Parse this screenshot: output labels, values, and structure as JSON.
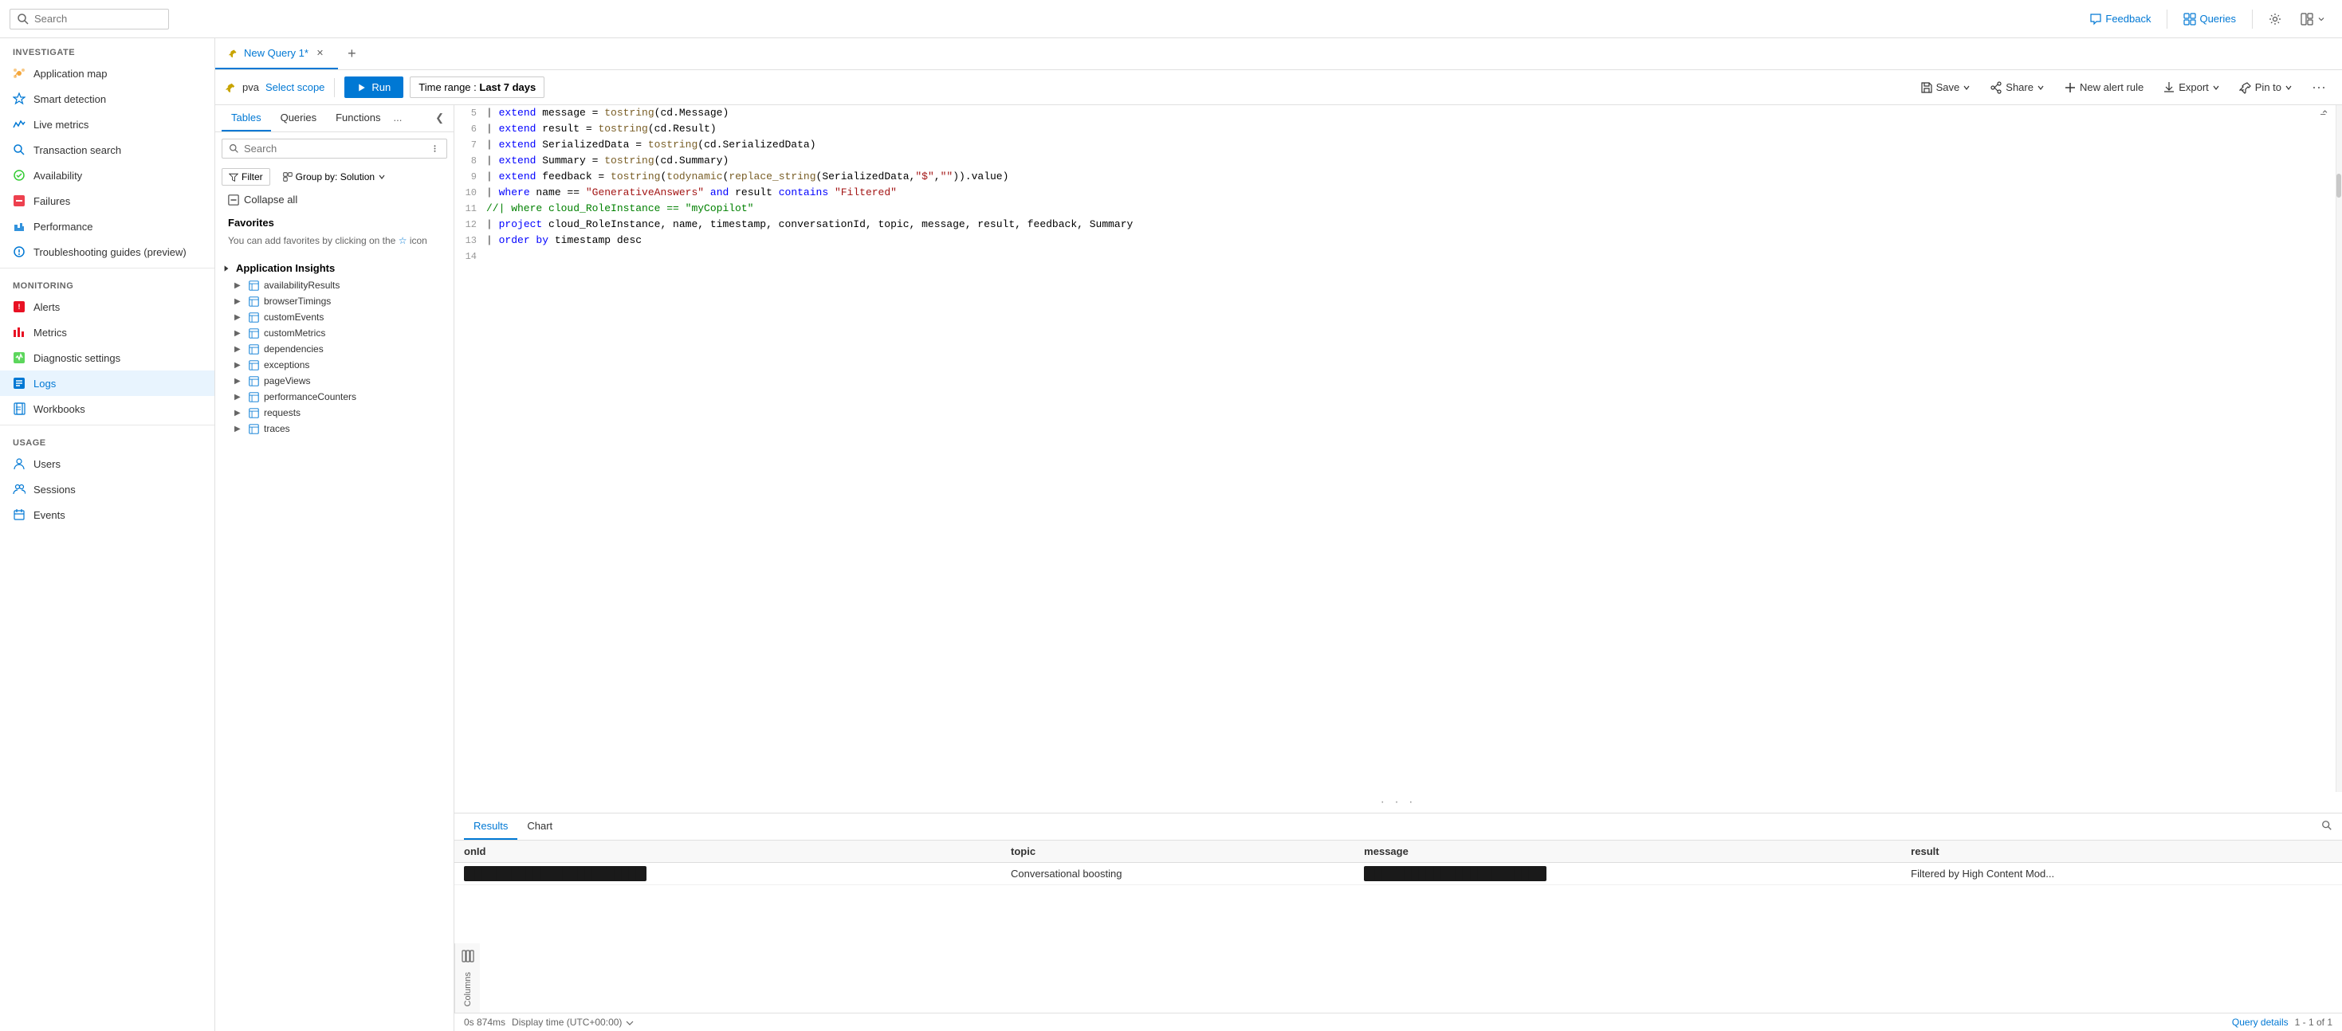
{
  "topbar": {
    "search_placeholder": "Search",
    "feedback_label": "Feedback",
    "queries_label": "Queries",
    "settings_tooltip": "Settings",
    "layout_tooltip": "Layout"
  },
  "tabs": [
    {
      "label": "New Query 1*",
      "active": true
    },
    {
      "label": "+",
      "is_add": true
    }
  ],
  "toolbar": {
    "scope_name": "pva",
    "select_scope_label": "Select scope",
    "run_label": "Run",
    "time_range_label": "Time range :",
    "time_range_value": "Last 7 days",
    "save_label": "Save",
    "share_label": "Share",
    "new_alert_label": "New alert rule",
    "export_label": "Export",
    "pin_to_label": "Pin to"
  },
  "schema": {
    "tables_label": "Tables",
    "queries_label": "Queries",
    "functions_label": "Functions",
    "more_label": "...",
    "search_placeholder": "Search",
    "filter_label": "Filter",
    "group_by_label": "Group by: Solution",
    "collapse_all_label": "Collapse all",
    "favorites_title": "Favorites",
    "favorites_empty_1": "You can add favorites by clicking on the",
    "favorites_star": "☆",
    "favorites_empty_2": "icon",
    "app_insights_title": "Application Insights",
    "tables": [
      "availabilityResults",
      "browserTimings",
      "customEvents",
      "customMetrics",
      "dependencies",
      "exceptions",
      "pageViews",
      "performanceCounters",
      "requests",
      "traces"
    ]
  },
  "editor": {
    "lines": [
      {
        "num": "5",
        "content": "| extend message = tostring(cd.Message)",
        "type": "normal"
      },
      {
        "num": "6",
        "content": "| extend result = tostring(cd.Result)",
        "type": "normal"
      },
      {
        "num": "7",
        "content": "| extend SerializedData = tostring(cd.SerializedData)",
        "type": "normal"
      },
      {
        "num": "8",
        "content": "| extend Summary = tostring(cd.Summary)",
        "type": "normal"
      },
      {
        "num": "9",
        "content": "| extend feedback = tostring(todynamic(replace_string(SerializedData,\"$\",\"\")).value)",
        "type": "normal"
      },
      {
        "num": "10",
        "content": "| where name == \"GenerativeAnswers\" and result contains \"Filtered\"",
        "type": "highlight"
      },
      {
        "num": "11",
        "content": "//| where cloud_RoleInstance == \"myCopilot\"",
        "type": "comment"
      },
      {
        "num": "12",
        "content": "| project cloud_RoleInstance, name, timestamp, conversationId, topic, message, result, feedback, Summary",
        "type": "normal"
      },
      {
        "num": "13",
        "content": "| order by timestamp desc",
        "type": "normal"
      },
      {
        "num": "14",
        "content": "",
        "type": "empty"
      }
    ]
  },
  "results": {
    "results_label": "Results",
    "chart_label": "Chart",
    "columns": [
      {
        "key": "onId",
        "label": "onId"
      },
      {
        "key": "topic",
        "label": "topic"
      },
      {
        "key": "message",
        "label": "message"
      },
      {
        "key": "result",
        "label": "result"
      }
    ],
    "rows": [
      {
        "onId": "[REDACTED]",
        "topic": "Conversational boosting",
        "message": "[REDACTED]",
        "result": "Filtered by High Content Mod..."
      }
    ]
  },
  "status": {
    "time": "0s 874ms",
    "display_time": "Display time (UTC+00:00)",
    "query_details_label": "Query details",
    "record_count": "1 - 1 of 1"
  },
  "sidebar": {
    "investigate_label": "Investigate",
    "items": [
      {
        "label": "Application map",
        "icon": "app-map",
        "color": "#f4a63a"
      },
      {
        "label": "Smart detection",
        "icon": "smart-detection",
        "color": "#0078d4"
      },
      {
        "label": "Live metrics",
        "icon": "live-metrics",
        "color": "#0078d4"
      },
      {
        "label": "Transaction search",
        "icon": "transaction-search",
        "color": "#0078d4"
      },
      {
        "label": "Availability",
        "icon": "availability",
        "color": "#33cc33"
      },
      {
        "label": "Failures",
        "icon": "failures",
        "color": "#e81123"
      },
      {
        "label": "Performance",
        "icon": "performance",
        "color": "#0078d4"
      },
      {
        "label": "Troubleshooting guides (preview)",
        "icon": "troubleshooting",
        "color": "#0078d4"
      }
    ],
    "monitoring_label": "Monitoring",
    "monitoring_items": [
      {
        "label": "Alerts",
        "icon": "alerts",
        "color": "#e81123"
      },
      {
        "label": "Metrics",
        "icon": "metrics",
        "color": "#e81123"
      },
      {
        "label": "Diagnostic settings",
        "icon": "diagnostic",
        "color": "#33cc33"
      },
      {
        "label": "Logs",
        "icon": "logs",
        "color": "#0078d4",
        "active": true
      },
      {
        "label": "Workbooks",
        "icon": "workbooks",
        "color": "#0078d4"
      }
    ],
    "usage_label": "Usage",
    "usage_items": [
      {
        "label": "Users",
        "icon": "users",
        "color": "#0078d4"
      },
      {
        "label": "Sessions",
        "icon": "sessions",
        "color": "#0078d4"
      },
      {
        "label": "Events",
        "icon": "events",
        "color": "#0078d4"
      }
    ]
  }
}
